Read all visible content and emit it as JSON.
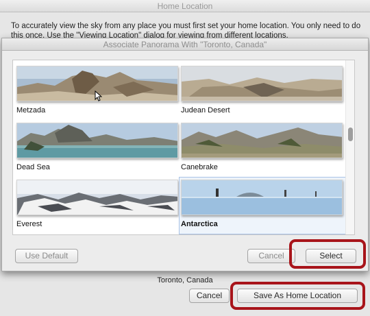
{
  "back_window": {
    "title": "Home Location",
    "intro_text": "To accurately view the sky from any place you must first set your home location. You only need to do this once. Use the \"Viewing Location\" dialog for viewing from different locations.",
    "location_label": "Toronto, Canada",
    "cancel_label": "Cancel",
    "save_label": "Save As Home Location"
  },
  "dialog": {
    "title": "Associate Panorama With \"Toronto, Canada\"",
    "use_default_label": "Use Default",
    "cancel_label": "Cancel",
    "select_label": "Select"
  },
  "panoramas": [
    {
      "label": "Metzada",
      "selected": false
    },
    {
      "label": "Judean Desert",
      "selected": false
    },
    {
      "label": "Dead Sea",
      "selected": false
    },
    {
      "label": "Canebrake",
      "selected": false
    },
    {
      "label": "Everest",
      "selected": false
    },
    {
      "label": "Antarctica",
      "selected": true
    }
  ],
  "colors": {
    "highlight": "#a8141a",
    "selection_border": "#a9c3e6"
  }
}
